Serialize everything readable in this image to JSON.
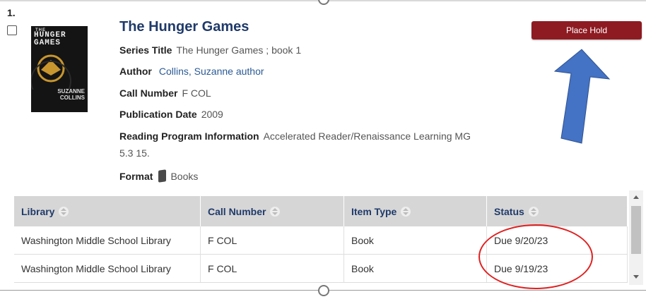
{
  "result": {
    "number": "1.",
    "title": "The Hunger Games",
    "cover": {
      "line1": "THE",
      "line2": "HUNGER GAMES",
      "author_line1": "SUZANNE",
      "author_line2": "COLLINS"
    },
    "series_label": "Series Title",
    "series_value": "The Hunger Games ; book 1",
    "author_label": "Author",
    "author_value": "Collins, Suzanne author",
    "call_label": "Call Number",
    "call_value": "F COL",
    "pubdate_label": "Publication Date",
    "pubdate_value": "2009",
    "reading_label": "Reading Program Information",
    "reading_value_line1": "Accelerated Reader/Renaissance Learning MG",
    "reading_value_line2": "5.3 15.",
    "format_label": "Format",
    "format_value": "Books",
    "format_icon": "book-icon"
  },
  "actions": {
    "place_hold": "Place Hold",
    "place_hold_color": "#8e1b22"
  },
  "holdings": {
    "headers": [
      "Library",
      "Call Number",
      "Item Type",
      "Status"
    ],
    "rows": [
      [
        "Washington Middle School Library",
        "F COL",
        "Book",
        "Due 9/20/23"
      ],
      [
        "Washington Middle School Library",
        "F COL",
        "Book",
        "Due 9/19/23"
      ]
    ]
  },
  "annotations": {
    "arrow_color": "#4472c4",
    "circle_color": "#e02020"
  }
}
